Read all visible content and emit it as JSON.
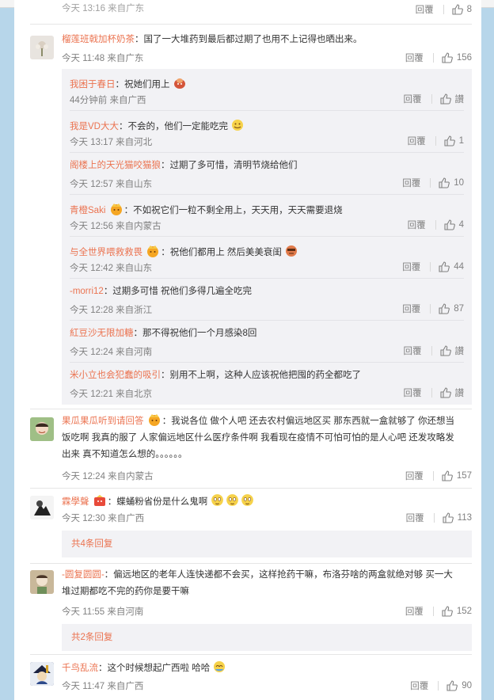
{
  "ui": {
    "reply_label": "回覆",
    "like_icon": "thumbs-up-icon",
    "colors": {
      "username": "#eb7350",
      "meta": "#808080",
      "subbg": "#f2f2f5",
      "page_bg": "#b7d6ea"
    }
  },
  "top_partial": {
    "time": "今天 13:16 来自广东",
    "likes": "8"
  },
  "comments": [
    {
      "user": "榴莲班戟加杯奶茶",
      "text": "：国了一大堆药到最后都过期了也用不上记得也晒出来。",
      "time": "今天 11:48 来自广东",
      "likes": "156",
      "replies": [
        {
          "user": "我困于春日",
          "text": "：祝她们用上",
          "time": "44分钟前 来自广西",
          "likes": "讃"
        },
        {
          "user": "我是VD大大",
          "text": "：不会的，他们一定能吃完",
          "time": "今天 13:17 来自河北",
          "likes": "1"
        },
        {
          "user": "阁楼上的天光猫咬猫狼",
          "text": "：过期了多可惜，清明节烧给他们",
          "time": "今天 12:57 来自山东",
          "likes": "10"
        },
        {
          "user": "青橙Saki",
          "text": "：不如祝它们一粒不剩全用上，天天用，天天需要退烧",
          "time": "今天 12:56 来自内蒙古",
          "likes": "4"
        },
        {
          "user": "与全世界喂救救畏",
          "text": "：祝他们都用上 然后美美衰闺",
          "time": "今天 12:42 来自山东",
          "likes": "44"
        },
        {
          "user": "-morri12",
          "text": "：过期多可惜 祝他们多得几遍全吃完",
          "time": "今天 12:28 来自浙江",
          "likes": "87"
        },
        {
          "user": "紅豆沙无限加糖",
          "text": "：那不得祝他们一个月感染8回",
          "time": "今天 12:24 来自河南",
          "likes": "讃"
        },
        {
          "user": "米小立也会犯蠢的吸引",
          "text": "：别用不上啊，这种人应该祝他把囤的药全都吃了",
          "time": "今天 12:21 来自北京",
          "likes": "讃"
        }
      ]
    },
    {
      "user": "果瓜果瓜听到请回答",
      "text_line1": "：我说各位 做个人吧 还去农村偏远地区买 那东西就一盒就够了 你还想当",
      "text_line2": "饭吃啊 我真的服了 人家偏远地区什么医疗条件啊 我看现在疫情不可怕可怕的是人心吧 还发攻略发",
      "text_line3": "出来 真不知道怎么想的。。。。。。",
      "time": "今天 12:24 来自内蒙古",
      "likes": "157"
    },
    {
      "user": "霖學聲",
      "text": "：蝶蛹粉省份是什么鬼啊",
      "time": "今天 12:30 来自广西",
      "likes": "113",
      "more": "共4条回复"
    },
    {
      "user": "-圆复圆圆-",
      "text_line1": "：偏远地区的老年人连快递都不会买，这样抢药干嘛，布洛芬啥的两盒就绝对够 买一大",
      "text_line2": "堆过期都吃不完的药你是要干嘛",
      "time": "今天 11:55 来自河南",
      "likes": "152",
      "more": "共2条回复"
    },
    {
      "user": "千鸟乱流",
      "text": "：这个时候想起广西啦 哈哈",
      "time": "今天 11:47 来自广西",
      "likes": "90"
    }
  ]
}
